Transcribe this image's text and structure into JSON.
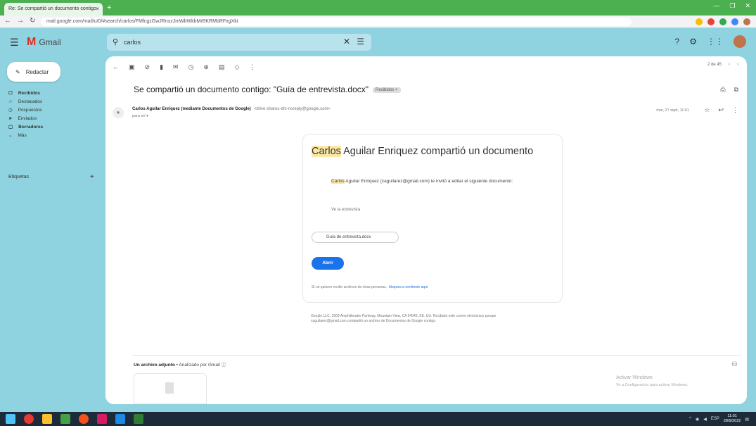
{
  "browser": {
    "tab_title": "Re: Se compartió un documento contigo",
    "tab_close": "×",
    "new_tab": "+",
    "url": "mail.google.com/mail/u/0/#search/carlos/FMfcgzGwJRnxzJmWbWkbMrBKRMbRFxgXkt"
  },
  "gmail": {
    "logo_text": "Gmail",
    "search_value": "carlos",
    "compose_label": "Redactar",
    "nav_items": [
      {
        "label": "Recibidos",
        "count": "",
        "active": true
      },
      {
        "label": "Destacados",
        "count": "",
        "active": false
      },
      {
        "label": "Pospuestos",
        "count": "",
        "active": false
      },
      {
        "label": "Enviados",
        "count": "",
        "active": false
      },
      {
        "label": "Borradores",
        "count": "",
        "active": true
      },
      {
        "label": "Más",
        "count": "",
        "active": false
      }
    ],
    "labels_heading": "Etiquetas",
    "pager": "2 de 45"
  },
  "email": {
    "subject": "Se compartió un documento contigo: \"Guía de entrevista.docx\"",
    "subject_chip": "Recibidos ×",
    "sender_name": "Carlos Aguilar Enriquez (mediante Documentos de Google)",
    "sender_email": "<drive-shares-dm-noreply@google.com>",
    "to_line": "para mí ▾",
    "date": "mar, 27 sept, 11:01",
    "card_title_highlight": "Carlos",
    "card_title_rest": " Aguilar Enriquez compartió un documento",
    "desc_highlight": "Carlos",
    "desc_rest": " Aguilar Enriquez (caguilarez@gmail.com) te invitó a editar el siguiente documento:",
    "view_line": "Ve la entrevista",
    "doc_name": "Guía de entrevista.docx",
    "open_label": "Abrir",
    "footer_text": "Si no quieres recibir archivos de otras personas,",
    "footer_link": "bloquea a remitente aquí",
    "legal": "Google LLC, 1600 Amphitheatre Parkway, Mountain View, CA 94043, EE. UU. Recibiste este correo electrónico porque caguilarez@gmail.com compartió un archivo de Documentos de Google contigo.",
    "attach_bold": "Un archivo adjunto",
    "attach_rest": " • Analizado por Gmail ⓘ",
    "watermark_1": "Activar Windows",
    "watermark_2": "Ve a Configuración para activar Windows."
  },
  "taskbar": {
    "tray_lang": "ESP",
    "time": "11:01",
    "date": "28/9/2022"
  }
}
